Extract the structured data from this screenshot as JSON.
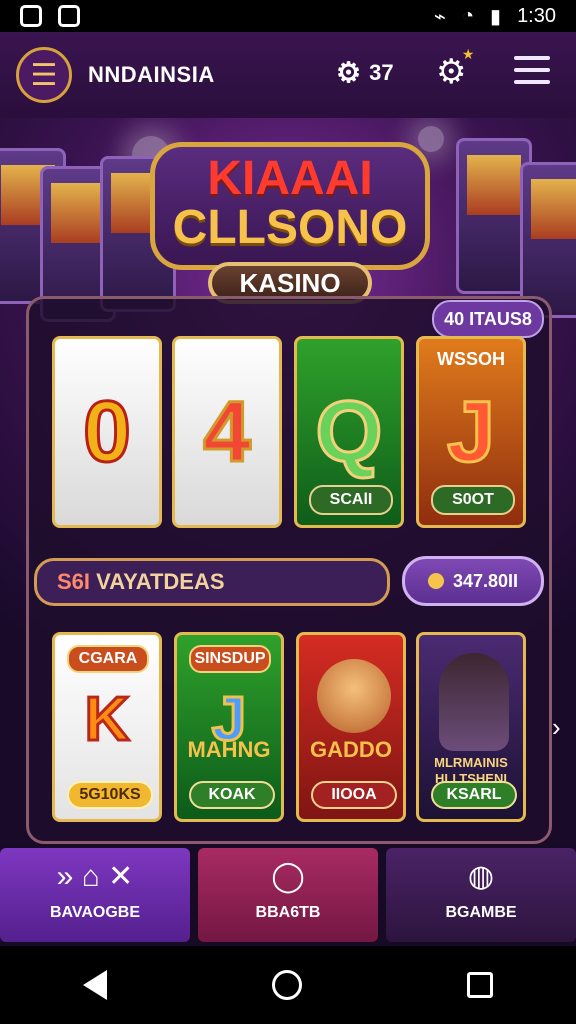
{
  "status": {
    "time": "1:30",
    "left_icons": [
      "camera-icon",
      "gallery-icon"
    ],
    "right_icons": [
      "vibrate-icon",
      "wifi-icon",
      "battery-icon"
    ]
  },
  "header": {
    "brand": "NNDAINSIA",
    "credits": "37",
    "menu_icon": "menu-icon",
    "settings_icon": "gear-icon",
    "drawer_icon": "hamburger-icon"
  },
  "logo": {
    "line1": "KIAAAI",
    "line2": "CLLSONO",
    "banner": "KASINO"
  },
  "panel": {
    "badge": "40 ITAUS8"
  },
  "reels": [
    {
      "symbol": "0",
      "top": "",
      "button": ""
    },
    {
      "symbol": "4",
      "top": "",
      "button": ""
    },
    {
      "symbol": "Q",
      "top": "",
      "button": "SCAlI"
    },
    {
      "symbol": "J",
      "top": "WSSOH",
      "button": "S0OT"
    }
  ],
  "winbar": {
    "prefix": "S6I",
    "text": "VAYATDEAS"
  },
  "balance": {
    "amount": "347.80II"
  },
  "cards": [
    {
      "header": "CGARA",
      "letter": "K",
      "caption": "",
      "button": "5G10KS"
    },
    {
      "header": "SINSDUP",
      "letter": "J",
      "caption": "MAHNG",
      "button": "KOAK"
    },
    {
      "header": "",
      "letter": "",
      "caption": "GADDO",
      "button": "IIOOA"
    },
    {
      "header": "",
      "letter": "",
      "caption": "",
      "button": "KSARL",
      "photo_text": "MLRMAINIS HLLTSHENI"
    }
  ],
  "bottom_nav": {
    "home": {
      "label": "BAVAOGBE"
    },
    "middle": {
      "label": "BBA6TB"
    },
    "right": {
      "label": "BGAMBE"
    }
  },
  "system_nav": {
    "back_icon": "back-icon",
    "home_icon": "home-circle-icon",
    "recent_icon": "recent-apps-icon"
  }
}
